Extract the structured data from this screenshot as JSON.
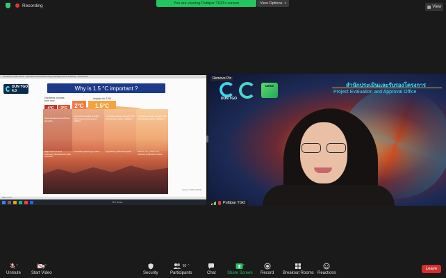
{
  "top_bar": {
    "recording_label": "Recording",
    "viewing_banner": "You are viewing Puttipar TGO's screen",
    "view_options_label": "View Options",
    "view_button_label": "View"
  },
  "shared_screen": {
    "window_title": "PowerPoint Slide Show - [aboutDueToClimateChange-withFigures-D2-Jul2021] - PowerPoint",
    "slide": {
      "logo_text": "DUN TGO 4.0",
      "title": "Why is 1.5 °C important ?",
      "label_historic": "Hundreds of years from now",
      "label_present": "Impacts for 2100",
      "temp_tags": [
        "4°C",
        "3°C",
        "2°C",
        "1.5°C"
      ],
      "row1": [
        "More frequent and extreme droughts",
        "16 months average drought 51% more burned area in wildfires",
        "4 months average drought 41% more burned area in wildfires",
        "2 months average drought 41% more burned area in wildfires"
      ],
      "row2": [
        "High levels of food insecurity, development path reversed",
        "Local fish species go extinct",
        "Agriculture yields fall rapidly",
        "Wheat, rice, maize and soybean production suffers"
      ],
      "source": "Source: WWF (2019)"
    },
    "status_bar": "Slide 3 of 13",
    "taskbar_text": "79°F Sunny"
  },
  "video_tile": {
    "remove_pin_label": "Remove Pin",
    "logo_dun_text": "DUN TGO",
    "logo_less_text": "LESS",
    "office_thai": "สำนักประเมินและรับรองโครงการ",
    "office_english": "Project Evaluation and Approval Office",
    "participant_name": "Puttipar TGO"
  },
  "toolbar": {
    "unmute": "Unmute",
    "start_video": "Start Video",
    "security": "Security",
    "participants": "Participants",
    "participants_count": "60",
    "chat": "Chat",
    "share_screen": "Share Screen",
    "record": "Record",
    "breakout_rooms": "Breakout Rooms",
    "reactions": "Reactions",
    "leave": "Leave"
  },
  "colors": {
    "banner_green": "#22c55e",
    "share_green": "#22c55e",
    "leave_red": "#d32f2f",
    "accent_cyan": "#36e4ff"
  }
}
